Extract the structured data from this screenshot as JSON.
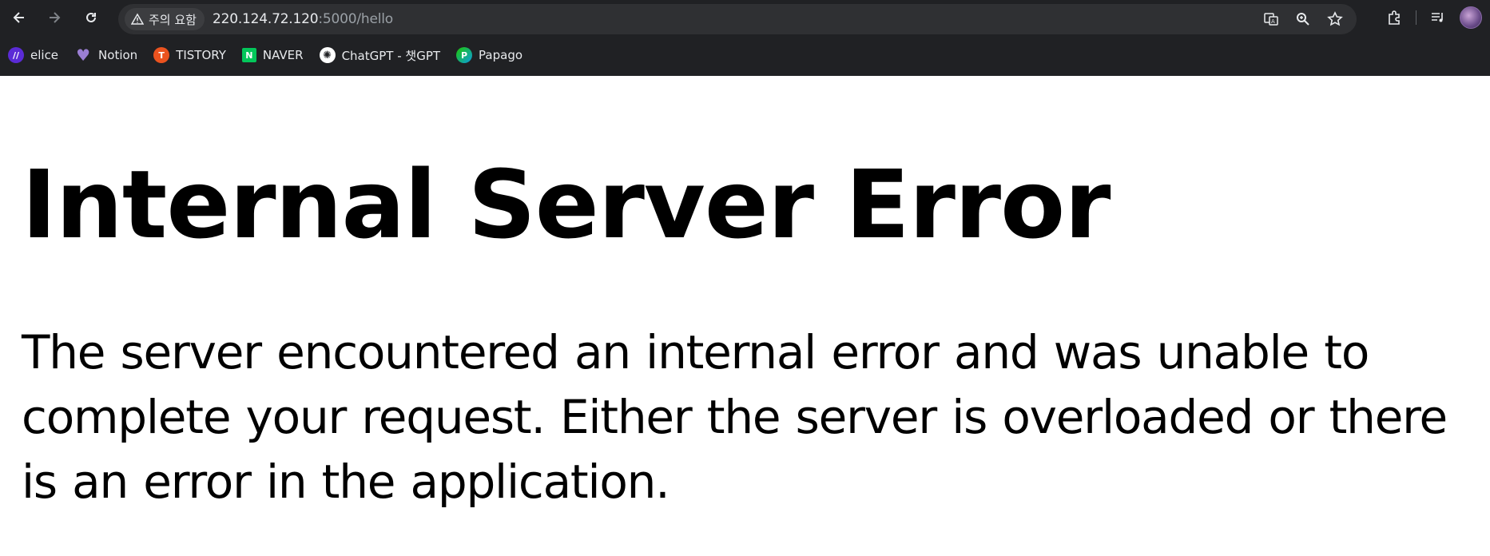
{
  "browser": {
    "security_label": "주의 요함",
    "url_host": "220.124.72.120",
    "url_rest": ":5000/hello",
    "icons": [
      "back-icon",
      "forward-icon",
      "reload-icon",
      "warning-icon",
      "translate-icon",
      "zoom-icon",
      "star-icon",
      "extensions-icon",
      "reading-list-icon",
      "profile-avatar"
    ]
  },
  "bookmarks": [
    {
      "label": "elice",
      "icon": "elice-icon",
      "color": "#5b2bd6",
      "glyph": "//"
    },
    {
      "label": "Notion",
      "icon": "heart-icon",
      "color": "#9b7fd4",
      "glyph": "♥"
    },
    {
      "label": "TISTORY",
      "icon": "tistory-icon",
      "color": "#eb531f",
      "glyph": "T"
    },
    {
      "label": "NAVER",
      "icon": "naver-icon",
      "color": "#03c75a",
      "glyph": "N"
    },
    {
      "label": "ChatGPT - 챗GPT",
      "icon": "chatgpt-icon",
      "color": "#ffffff",
      "glyph": "✺"
    },
    {
      "label": "Papago",
      "icon": "papago-icon",
      "color": "#1ec800",
      "glyph": "P"
    }
  ],
  "page": {
    "title": "Internal Server Error",
    "message": "The server encountered an internal error and was unable to complete your request. Either the server is overloaded or there is an error in the application."
  },
  "colors": {
    "chrome_bg": "#202124",
    "omnibox_bg": "#2f3033",
    "page_bg": "#ffffff",
    "text": "#000000"
  }
}
